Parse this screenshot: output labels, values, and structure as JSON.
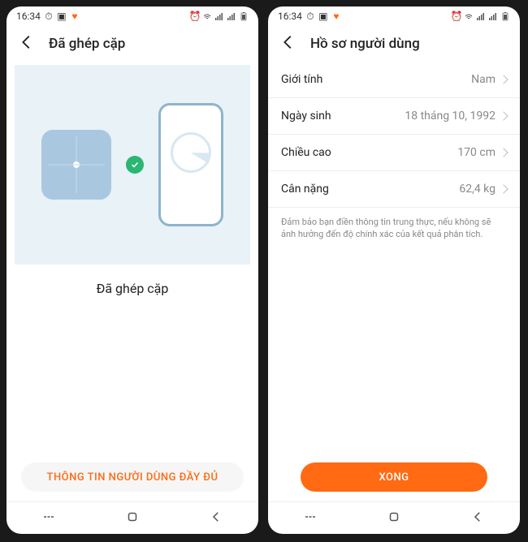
{
  "status": {
    "time": "16:34",
    "icons_left": [
      "clock-icon",
      "camera-icon",
      "heart-icon"
    ],
    "icons_right": [
      "alarm-icon",
      "wifi-icon",
      "signal-icon",
      "signal-icon",
      "battery-icon"
    ]
  },
  "left": {
    "header_title": "Đã ghép cặp",
    "paired_text": "Đã ghép cặp",
    "button_label": "THÔNG TIN NGƯỜI DÙNG ĐẦY ĐỦ"
  },
  "right": {
    "header_title": "Hồ sơ người dùng",
    "rows": [
      {
        "label": "Giới tính",
        "value": "Nam"
      },
      {
        "label": "Ngày sinh",
        "value": "18 tháng 10, 1992"
      },
      {
        "label": "Chiều cao",
        "value": "170 cm"
      },
      {
        "label": "Cân nặng",
        "value": "62,4 kg"
      }
    ],
    "hint": "Đảm bảo bạn điền thông tin trung thực, nếu không sẽ ảnh hưởng đến độ chính xác của kết quả phân tích.",
    "done_label": "XONG"
  }
}
